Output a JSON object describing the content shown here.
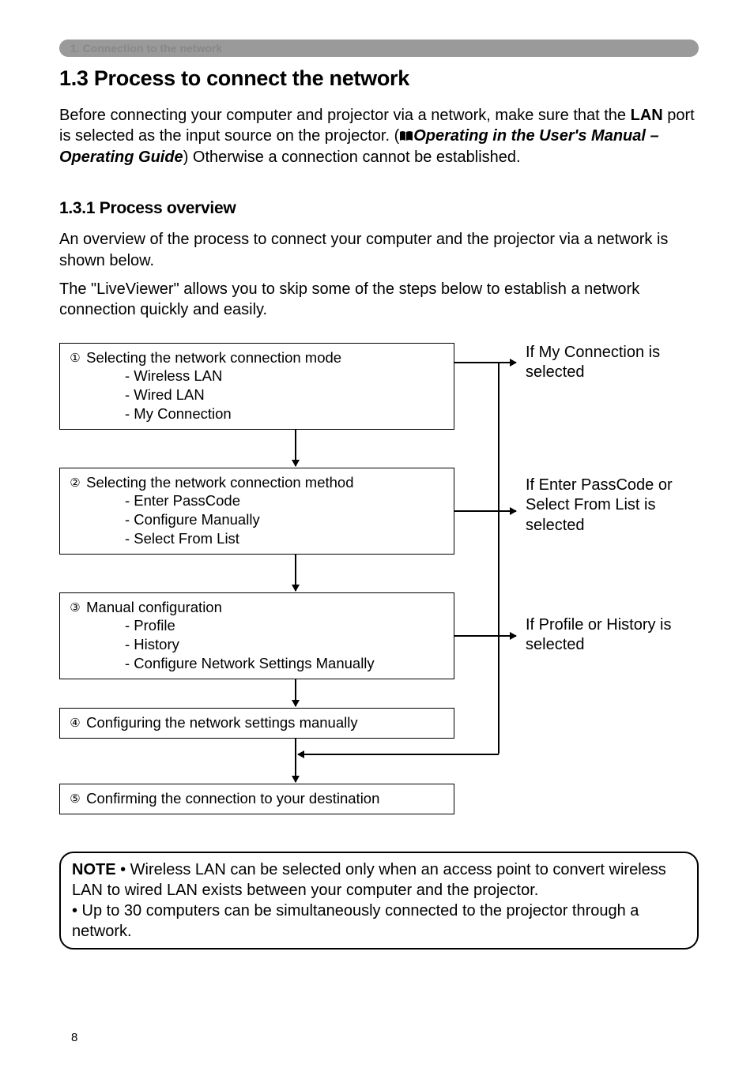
{
  "header_pill": "1. Connection to the network",
  "title": "1.3 Process to connect the network",
  "intro": {
    "p1a": "Before connecting your computer and projector via a network, make sure that the ",
    "lan": "LAN",
    "p1b": " port is selected as the input source on the projector. (",
    "ref": "Operating in the User's Manual – Operating Guide",
    "p1c": ") Otherwise a connection cannot be established."
  },
  "subtitle": "1.3.1 Process overview",
  "overview": {
    "p1": "An overview of the process to connect your computer and the projector via a network is shown below.",
    "p2": "The \"LiveViewer\" allows you to skip some of the steps below to establish a network connection quickly and easily."
  },
  "steps": {
    "s1": {
      "num": "①",
      "title": " Selecting the network connection mode",
      "items": [
        "- Wireless LAN",
        "- Wired LAN",
        "- My Connection"
      ]
    },
    "s2": {
      "num": "②",
      "title": " Selecting the network connection method",
      "items": [
        "- Enter PassCode",
        "- Configure Manually",
        "- Select From List"
      ]
    },
    "s3": {
      "num": "③",
      "title": " Manual configuration",
      "items": [
        "- Profile",
        "- History",
        "- Configure Network Settings Manually"
      ]
    },
    "s4": {
      "num": "④",
      "title": " Configuring the network settings manually"
    },
    "s5": {
      "num": "⑤",
      "title": " Confirming the connection to your destination"
    }
  },
  "side_labels": {
    "l1": "If My Connection is selected",
    "l2": "If Enter PassCode or Select From List is selected",
    "l3": "If Profile or History is selected"
  },
  "note": {
    "label": "NOTE",
    "body1": "  • Wireless LAN can be selected only when an access point to convert wireless LAN to wired LAN exists between your computer and the projector.",
    "body2": "• Up to 30 computers can be simultaneously connected to the projector through a network."
  },
  "page_number": "8"
}
